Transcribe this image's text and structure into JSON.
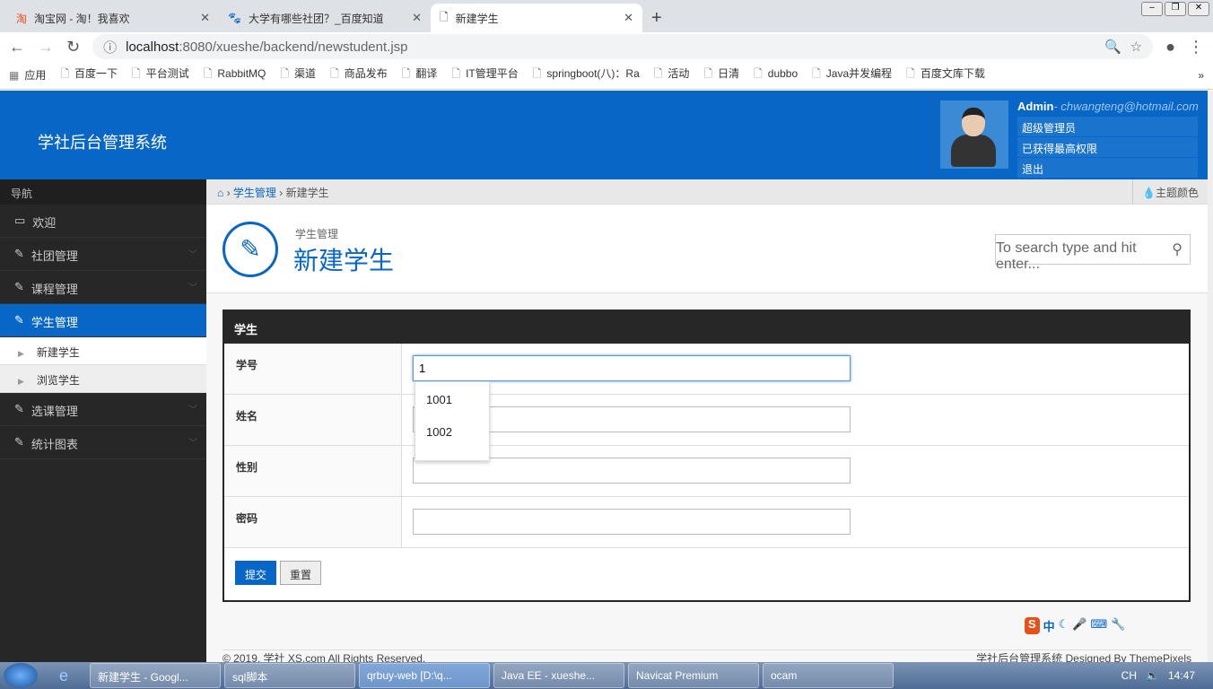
{
  "browser": {
    "tabs": [
      {
        "title": "淘宝网 - 淘！我喜欢",
        "icon": "taobao-icon"
      },
      {
        "title": "大学有哪些社团？_百度知道",
        "icon": "baidu-icon"
      },
      {
        "title": "新建学生",
        "icon": "page-icon"
      }
    ],
    "url_host": "localhost",
    "url_rest": ":8080/xueshe/backend/newstudent.jsp",
    "bookmarks": [
      "应用",
      "百度一下",
      "平台测试",
      "RabbitMQ",
      "渠道",
      "商品发布",
      "翻译",
      "IT管理平台",
      "springboot(八)：Ra",
      "活动",
      "日清",
      "dubbo",
      "Java并发编程",
      "百度文库下载"
    ]
  },
  "header": {
    "logo": "学社后台管理系统",
    "user": "Admin",
    "email": "- chwangteng@hotmail.com",
    "menu": [
      "超级管理员",
      "已获得最高权限",
      "退出"
    ]
  },
  "sidebar": {
    "title": "导航",
    "items": [
      "欢迎",
      "社团管理",
      "课程管理",
      "学生管理",
      "选课管理",
      "统计图表"
    ],
    "sub": [
      "新建学生",
      "浏览学生"
    ]
  },
  "breadcrumb": {
    "parent": "学生管理",
    "current": "新建学生",
    "theme": "主题颜色"
  },
  "page": {
    "subtitle": "学生管理",
    "title": "新建学生",
    "search_placeholder": "To search type and hit enter..."
  },
  "form": {
    "title": "学生",
    "fields": [
      {
        "label": "学号",
        "value": "1"
      },
      {
        "label": "姓名",
        "value": ""
      },
      {
        "label": "性别",
        "value": ""
      },
      {
        "label": "密码",
        "value": ""
      }
    ],
    "submit": "提交",
    "reset": "重置",
    "suggestions": [
      "1001",
      "1002"
    ]
  },
  "footer": {
    "left": "© 2019. 学社 XS.com All Rights Reserved.",
    "right": "学社后台管理系统  Designed By ThemePixels"
  },
  "taskbar": {
    "items": [
      "新建学生 - Googl...",
      "sql脚本",
      "qrbuy-web [D:\\q...",
      "Java EE - xueshe...",
      "Navicat Premium",
      "ocam"
    ],
    "lang": "CH",
    "time": "14:47"
  },
  "ime": {
    "label": "中"
  }
}
